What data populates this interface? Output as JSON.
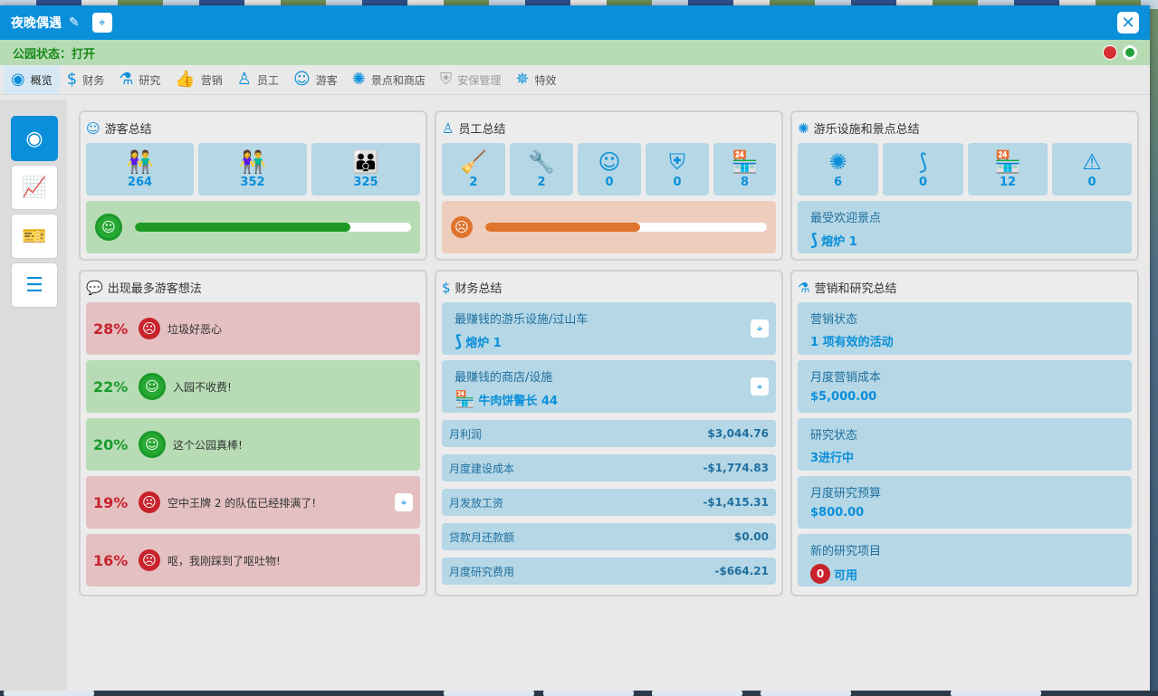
{
  "window": {
    "title": "夜晚偶遇",
    "close_icon": "close-icon",
    "edit_icon": "pencil-icon",
    "locate_icon": "map-pin-icon"
  },
  "status": {
    "text": "公园状态：打开",
    "indicators": [
      "red",
      "green"
    ]
  },
  "tabs": [
    {
      "label": "概览",
      "icon": "eye-icon",
      "active": true
    },
    {
      "label": "财务",
      "icon": "dollar-icon"
    },
    {
      "label": "研究",
      "icon": "flask-icon"
    },
    {
      "label": "营销",
      "icon": "thumbs-up-icon"
    },
    {
      "label": "员工",
      "icon": "staff-icon"
    },
    {
      "label": "游客",
      "icon": "guests-icon"
    },
    {
      "label": "景点和商店",
      "icon": "ferris-wheel-icon"
    },
    {
      "label": "安保管理",
      "icon": "shield-icon",
      "disabled": true
    },
    {
      "label": "特效",
      "icon": "fireworks-icon"
    }
  ],
  "sidebar": [
    {
      "icon": "eye-icon",
      "active": true
    },
    {
      "icon": "chart-icon"
    },
    {
      "icon": "ticket-icon"
    },
    {
      "icon": "list-icon"
    }
  ],
  "guest_summary": {
    "title": "游客总结",
    "tiles": [
      {
        "icon": "guest-pair-icon",
        "value": "264"
      },
      {
        "icon": "guest-pair-icon",
        "value": "352"
      },
      {
        "icon": "guest-family-icon",
        "value": "325"
      }
    ],
    "happiness_fraction": 0.78
  },
  "staff_summary": {
    "title": "员工总结",
    "tiles": [
      {
        "icon": "broom-icon",
        "value": "2"
      },
      {
        "icon": "wrench-icon",
        "value": "2"
      },
      {
        "icon": "entertainer-icon",
        "value": "0"
      },
      {
        "icon": "security-badge-icon",
        "value": "0"
      },
      {
        "icon": "shop-icon",
        "value": "8"
      }
    ],
    "happiness_fraction": 0.55
  },
  "rides_summary": {
    "title": "游乐设施和景点总结",
    "tiles": [
      {
        "icon": "ferris-wheel-icon",
        "value": "6"
      },
      {
        "icon": "coaster-icon",
        "value": "0"
      },
      {
        "icon": "shop-icon",
        "value": "12"
      },
      {
        "icon": "alert-icon",
        "value": "0"
      }
    ],
    "favorite_label": "最受欢迎景点",
    "favorite_value": "熔炉 1"
  },
  "thoughts": {
    "title": "出现最多游客想法",
    "items": [
      {
        "pct": "28%",
        "mood": "bad",
        "text": "垃圾好恶心"
      },
      {
        "pct": "22%",
        "mood": "good",
        "text": "入园不收费!"
      },
      {
        "pct": "20%",
        "mood": "good",
        "text": "这个公园真棒!"
      },
      {
        "pct": "19%",
        "mood": "bad",
        "text": "空中王牌 2 的队伍已经排满了!"
      },
      {
        "pct": "16%",
        "mood": "bad",
        "text": "呕，我刚踩到了呕吐物!"
      }
    ]
  },
  "finance": {
    "title": "财务总结",
    "top_ride_label": "最赚钱的游乐设施/过山车",
    "top_ride_value": "熔炉 1",
    "top_shop_label": "最赚钱的商店/设施",
    "top_shop_value": "牛肉饼警长 44",
    "rows": [
      {
        "label": "月利润",
        "value": "$3,044.76"
      },
      {
        "label": "月度建设成本",
        "value": "-$1,774.83"
      },
      {
        "label": "月发放工资",
        "value": "-$1,415.31"
      },
      {
        "label": "贷款月还款额",
        "value": "$0.00"
      },
      {
        "label": "月度研究费用",
        "value": "-$664.21"
      }
    ]
  },
  "marketing": {
    "title": "营销和研究总结",
    "cards": [
      {
        "label": "营销状态",
        "value": "1 项有效的活动"
      },
      {
        "label": "月度营销成本",
        "value": "$5,000.00"
      },
      {
        "label": "研究状态",
        "value": "3进行中"
      },
      {
        "label": "月度研究预算",
        "value": "$800.00"
      }
    ],
    "new_research_label": "新的研究项目",
    "new_research_count": "0",
    "new_research_suffix": "可用"
  }
}
